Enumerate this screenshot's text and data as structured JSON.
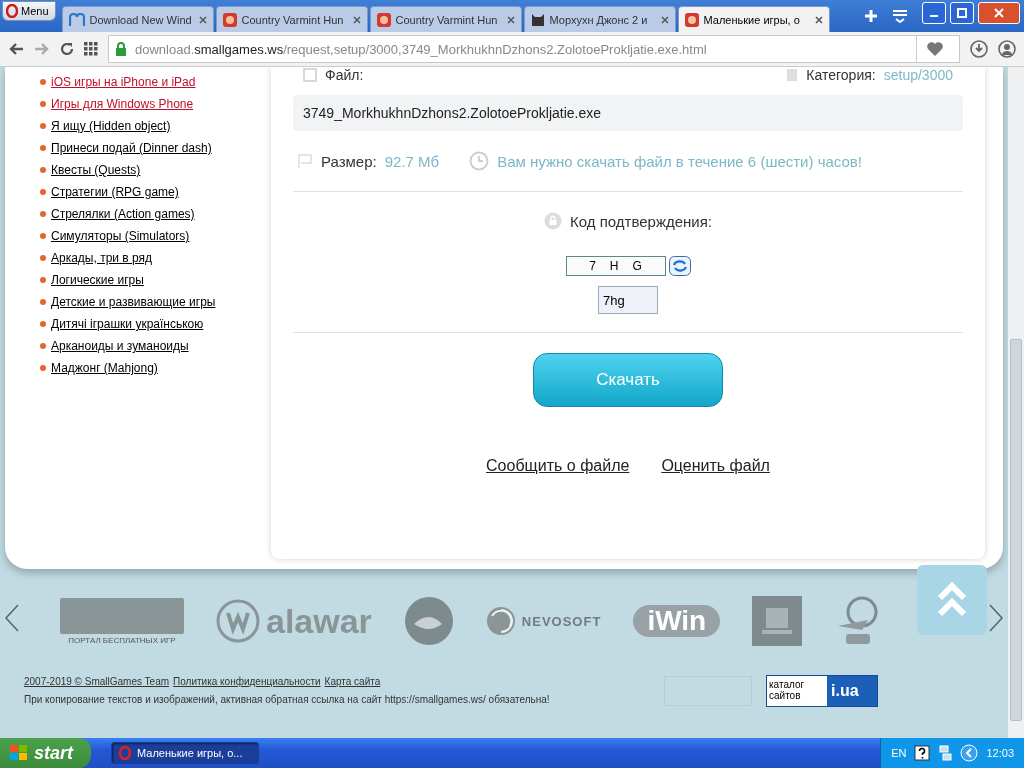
{
  "browser": {
    "menu_label": "Menu",
    "tabs": [
      {
        "label": "Download New Wind",
        "selected": false,
        "kind": "m"
      },
      {
        "label": "Country Varmint Hun",
        "selected": false,
        "kind": "game"
      },
      {
        "label": "Country Varmint Hun",
        "selected": false,
        "kind": "game"
      },
      {
        "label": "Морхухн Джонс 2 и",
        "selected": false,
        "kind": "cat"
      },
      {
        "label": "Маленькие игры, о",
        "selected": true,
        "kind": "game"
      }
    ],
    "url": "download.**smallgames.ws**/request,setup/3000,3749_MorkhukhnDzhons2.ZolotoeProkljatie.exe.html"
  },
  "sidebar": {
    "items": [
      {
        "label": "iOS игры на iPhone и iPad",
        "visited": true
      },
      {
        "label": "Игры для Windows Phone",
        "visited": true
      },
      {
        "label": "Я ищу (Hidden object)",
        "visited": false
      },
      {
        "label": "Принеси подай (Dinner dash)",
        "visited": false
      },
      {
        "label": "Квесты (Quests)",
        "visited": false
      },
      {
        "label": "Стратегии (RPG game)",
        "visited": false
      },
      {
        "label": "Стрелялки (Action games)",
        "visited": false
      },
      {
        "label": "Симуляторы (Simulators)",
        "visited": false
      },
      {
        "label": "Аркады, три в ряд",
        "visited": false
      },
      {
        "label": "Логические игры",
        "visited": false
      },
      {
        "label": "Детские и развивающие игры",
        "visited": false
      },
      {
        "label": "Дитячі іграшки українською",
        "visited": false
      },
      {
        "label": "Арканоиды и зуманоиды",
        "visited": false
      },
      {
        "label": "Маджонг (Mahjong)",
        "visited": false
      }
    ]
  },
  "download": {
    "file_label": "Файл:",
    "category_label": "Категория:",
    "category_value": "setup/3000",
    "file_name": "3749_MorkhukhnDzhons2.ZolotoeProkljatie.exe",
    "size_label": "Размер:",
    "size_value": "92.7 Мб",
    "deadline": "Вам нужно скачать файл в течение 6 (шести) часов!",
    "captcha_label": "Код подтверждения:",
    "captcha_chars": [
      "7",
      "H",
      "G"
    ],
    "captcha_value": "7hg",
    "download_button": "Скачать",
    "links": [
      "Сообщить о файле",
      "Оценить файл"
    ]
  },
  "footer": {
    "logos": [
      {
        "kind": "portal",
        "text": "ПОРТАЛ БЕСПЛАТНЫХ ИГР"
      },
      {
        "kind": "alawar",
        "text": "alawar"
      },
      {
        "kind": "bigfish"
      },
      {
        "kind": "nevosoft",
        "text": "NEVOSOFT"
      },
      {
        "kind": "iwin",
        "text": "iWin"
      },
      {
        "kind": "square"
      },
      {
        "kind": "badge"
      }
    ],
    "copyright_links": [
      "2007-2019 © SmallGames Team",
      "Политика конфиденциальности",
      "Карта сайта"
    ],
    "notice": "При копирование текстов и изображений, активная обратная ссылка на сайт https://smallgames.ws/ обязательна!",
    "catalog": {
      "text": "каталог сайтов",
      "brand": "i.ua"
    }
  },
  "taskbar": {
    "start": "start",
    "tasks": [
      {
        "label": "Маленькие игры, о...",
        "selected": true
      }
    ],
    "language": "EN",
    "clock": "12:03"
  }
}
